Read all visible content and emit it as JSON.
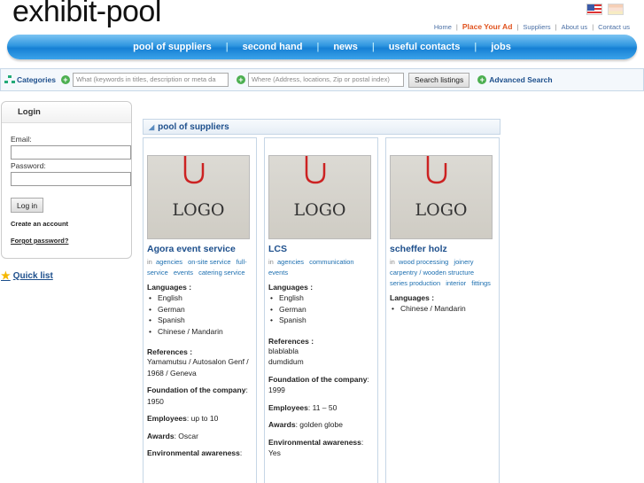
{
  "site": {
    "title": "exhibit-pool"
  },
  "top_links": {
    "home": "Home",
    "place_ad": "Place Your Ad",
    "suppliers": "Suppliers",
    "about": "About us",
    "contact": "Contact us"
  },
  "nav": [
    "pool of suppliers",
    "second hand",
    "news",
    "useful contacts",
    "jobs"
  ],
  "search": {
    "categories_label": "Categories",
    "what_placeholder": "What (keywords in titles, description or meta da",
    "where_placeholder": "Where (Address, locations, Zip or postal index)",
    "button": "Search listings",
    "advanced": "Advanced Search"
  },
  "login": {
    "title": "Login",
    "email_label": "Email:",
    "password_label": "Password:",
    "button": "Log in",
    "create_account": "Create an account",
    "forgot": "Forgot password?"
  },
  "quick_list": "Quick list",
  "section_title": "pool of suppliers",
  "labels": {
    "in": "in",
    "languages": "Languages",
    "references": "References",
    "foundation": "Foundation of the company",
    "employees": "Employees",
    "awards": "Awards",
    "environmental": "Environmental awareness",
    "logo": "LOGO"
  },
  "cards": [
    {
      "name": "Agora event service",
      "tags": [
        "agencies",
        "on-site service",
        "full-service",
        "events",
        "catering service"
      ],
      "languages": [
        "English",
        "German",
        "Spanish",
        "Chinese / Mandarin"
      ],
      "references": "Yamamutsu / Autosalon Genf / 1968 / Geneva",
      "foundation": "1950",
      "employees": "up to 10",
      "awards": "Oscar"
    },
    {
      "name": "LCS",
      "tags": [
        "agencies",
        "communication",
        "events"
      ],
      "languages": [
        "English",
        "German",
        "Spanish"
      ],
      "references_lines": [
        "blablabla",
        "dumdidum"
      ],
      "foundation": "1999",
      "employees": "11 – 50",
      "awards": "golden globe",
      "environmental": "Yes"
    },
    {
      "name": "scheffer holz",
      "tags": [
        "wood processing",
        "joinery",
        "carpentry / wooden structure",
        "series production",
        "interior",
        "fittings"
      ],
      "languages": [
        "Chinese / Mandarin"
      ]
    }
  ],
  "colors": {
    "nav_blue": "#1680d4",
    "link_blue": "#1d4f8c",
    "accent_orange": "#e0531f"
  }
}
